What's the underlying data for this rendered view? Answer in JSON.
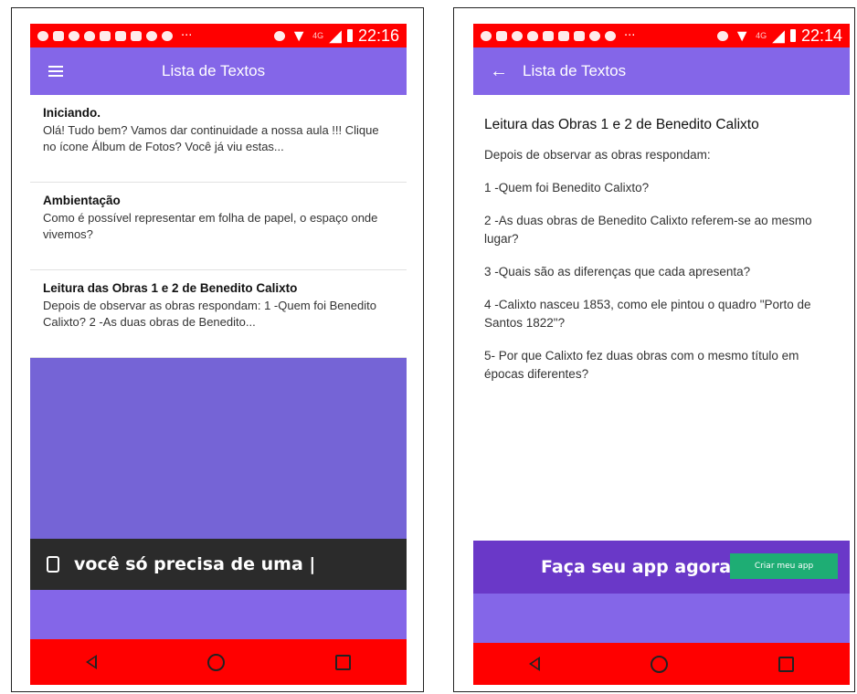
{
  "colors": {
    "status_bar": "#ff0000",
    "app_bar": "#8466e8",
    "list_background": "#7564d6",
    "ad_dark": "#2b2b2b",
    "ad_purple": "#6a38c8",
    "ad_button": "#1ead74",
    "nav_bar": "#ff0000"
  },
  "left": {
    "status": {
      "time": "22:16",
      "network": "4G"
    },
    "appbar": {
      "title": "Lista de Textos",
      "icon": "menu-icon"
    },
    "items": [
      {
        "title": "Iniciando.",
        "body": "Olá! Tudo bem? Vamos dar continuidade a nossa aula !!! Clique no ícone Álbum de Fotos? Você já viu estas..."
      },
      {
        "title": "Ambientação",
        "body": "Como é possível representar em folha de papel, o espaço onde vivemos?"
      },
      {
        "title": "Leitura das Obras 1 e 2 de Benedito Calixto",
        "body": "Depois de observar as obras respondam: 1 -Quem foi Benedito Calixto? 2 -As duas obras de Benedito..."
      }
    ],
    "ad": {
      "text": "você só precisa de uma |"
    }
  },
  "right": {
    "status": {
      "time": "22:14",
      "network": "4G"
    },
    "appbar": {
      "title": "Lista de Textos",
      "icon": "back-arrow-icon"
    },
    "detail": {
      "title": "Leitura das Obras 1 e 2 de Benedito Calixto",
      "paragraphs": [
        "Depois de observar as obras respondam:",
        "1 -Quem foi Benedito Calixto?",
        "2 -As duas obras de Benedito Calixto referem-se ao mesmo lugar?",
        "3 -Quais são as diferenças que cada apresenta?",
        "4 -Calixto nasceu 1853, como ele pintou o quadro \"Porto de Santos 1822\"?",
        "5- Por que Calixto fez duas obras com o mesmo título em épocas diferentes?"
      ]
    },
    "ad": {
      "text": "Faça seu app agora",
      "button": "Criar meu app"
    }
  }
}
